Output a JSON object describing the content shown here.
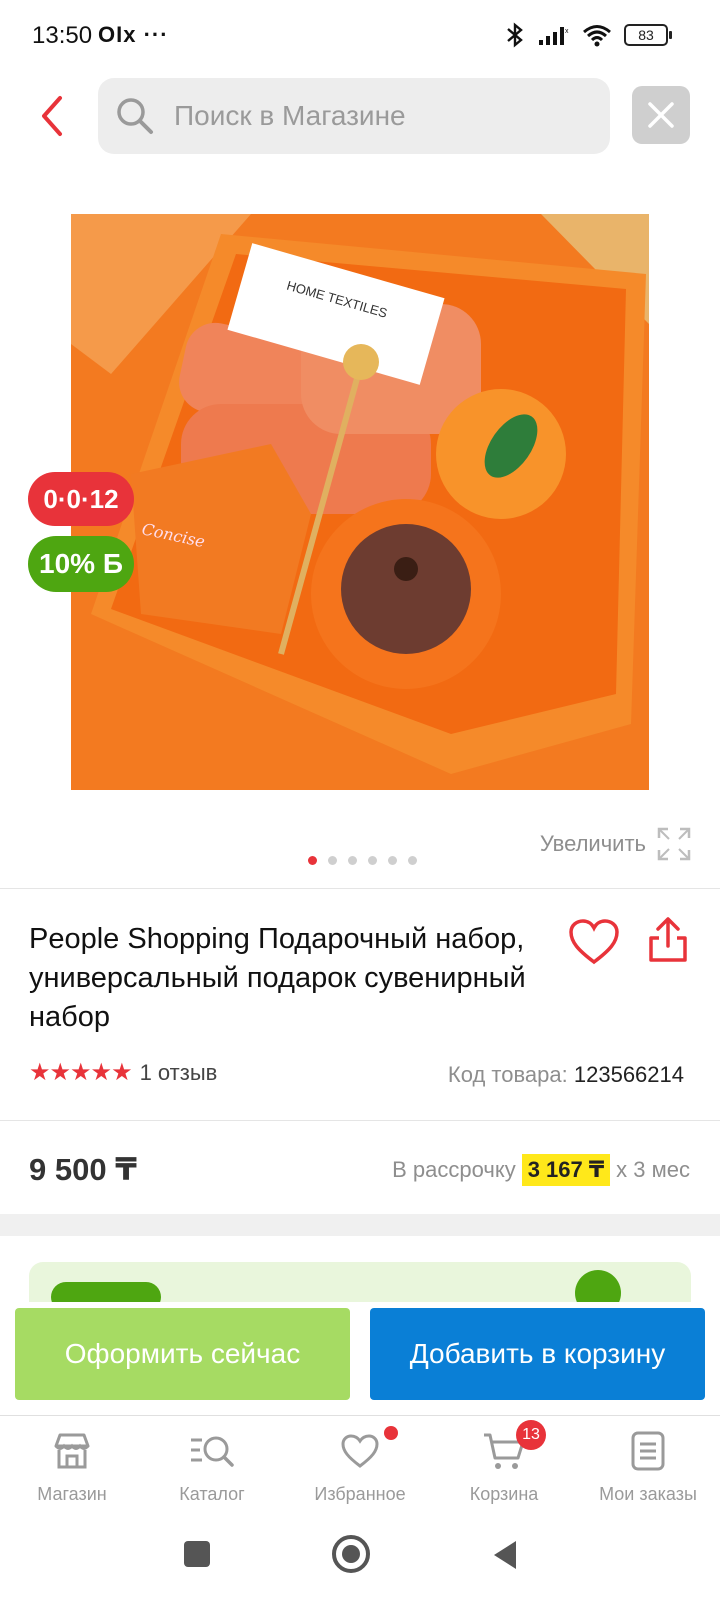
{
  "status_bar": {
    "time": "13:50",
    "left_icons": "OIx ···",
    "battery": "83"
  },
  "search": {
    "placeholder": "Поиск в Магазине"
  },
  "product": {
    "badge_timer": "0·0·12",
    "badge_bonus": "10% Б",
    "zoom_label": "Увеличить",
    "image_count": 6,
    "active_image": 1,
    "title": "People Shopping Подарочный набор, универсальный подарок сувенирный набор",
    "rating_stars": 5,
    "reviews": "1 отзыв",
    "sku_label": "Код товара:",
    "sku_value": "123566214",
    "price": "9 500 ₸",
    "installment_label": "В рассрочку",
    "installment_value": "3 167 ₸",
    "installment_term": "х 3 мес",
    "image_texts": {
      "card": "HOME TEXTILES",
      "cup": "Concise"
    }
  },
  "actions": {
    "checkout": "Оформить сейчас",
    "add_to_cart": "Добавить в корзину"
  },
  "nav": {
    "items": [
      {
        "label": "Магазин",
        "icon": "store-icon"
      },
      {
        "label": "Каталог",
        "icon": "catalog-search-icon"
      },
      {
        "label": "Избранное",
        "icon": "heart-icon"
      },
      {
        "label": "Корзина",
        "icon": "cart-icon"
      },
      {
        "label": "Мои заказы",
        "icon": "orders-icon"
      }
    ],
    "cart_count": "13"
  },
  "colors": {
    "accent_red": "#e8333a",
    "checkout_green": "#a6db63",
    "cart_blue": "#0a7fd6",
    "bonus_green": "#4ea611"
  }
}
